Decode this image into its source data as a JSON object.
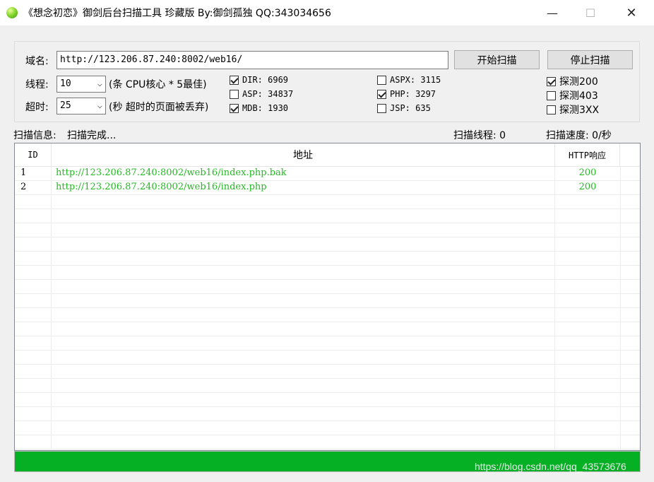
{
  "window": {
    "title": "《想念初恋》御剑后台扫描工具 珍藏版 By:御剑孤独 QQ:343034656",
    "controls": {
      "minimize": "—",
      "maximize": "☐",
      "close": "✕"
    }
  },
  "form": {
    "domain_label": "域名:",
    "domain_value": "http://123.206.87.240:8002/web16/",
    "start_button": "开始扫描",
    "stop_button": "停止扫描",
    "threads_label": "线程:",
    "threads_value": "10",
    "threads_hint": "(条 CPU核心 * 5最佳)",
    "timeout_label": "超时:",
    "timeout_value": "25",
    "timeout_hint": "(秒 超时的页面被丢弃)"
  },
  "dictionaries": [
    {
      "label": "DIR: 6969",
      "checked": true
    },
    {
      "label": "ASP: 34837",
      "checked": false
    },
    {
      "label": "MDB: 1930",
      "checked": true
    },
    {
      "label": "ASPX: 3115",
      "checked": false
    },
    {
      "label": "PHP: 3297",
      "checked": true
    },
    {
      "label": "JSP: 635",
      "checked": false
    }
  ],
  "probes": [
    {
      "label": "探测200",
      "checked": true
    },
    {
      "label": "探测403",
      "checked": false
    },
    {
      "label": "探测3XX",
      "checked": false
    }
  ],
  "status": {
    "info_label": "扫描信息:",
    "info_value": "扫描完成...",
    "threads_text": "扫描线程: 0",
    "speed_text": "扫描速度: 0/秒"
  },
  "table": {
    "columns": [
      "ID",
      "地址",
      "HTTP响应"
    ],
    "rows": [
      {
        "id": "1",
        "url": "http://123.206.87.240:8002/web16/index.php.bak",
        "code": "200"
      },
      {
        "id": "2",
        "url": "http://123.206.87.240:8002/web16/index.php",
        "code": "200"
      }
    ]
  },
  "progress": {
    "value": 1.0,
    "color": "#06b025"
  },
  "watermark": "https://blog.csdn.net/qq_43573676",
  "colors": {
    "result_text": "#22bb22"
  }
}
